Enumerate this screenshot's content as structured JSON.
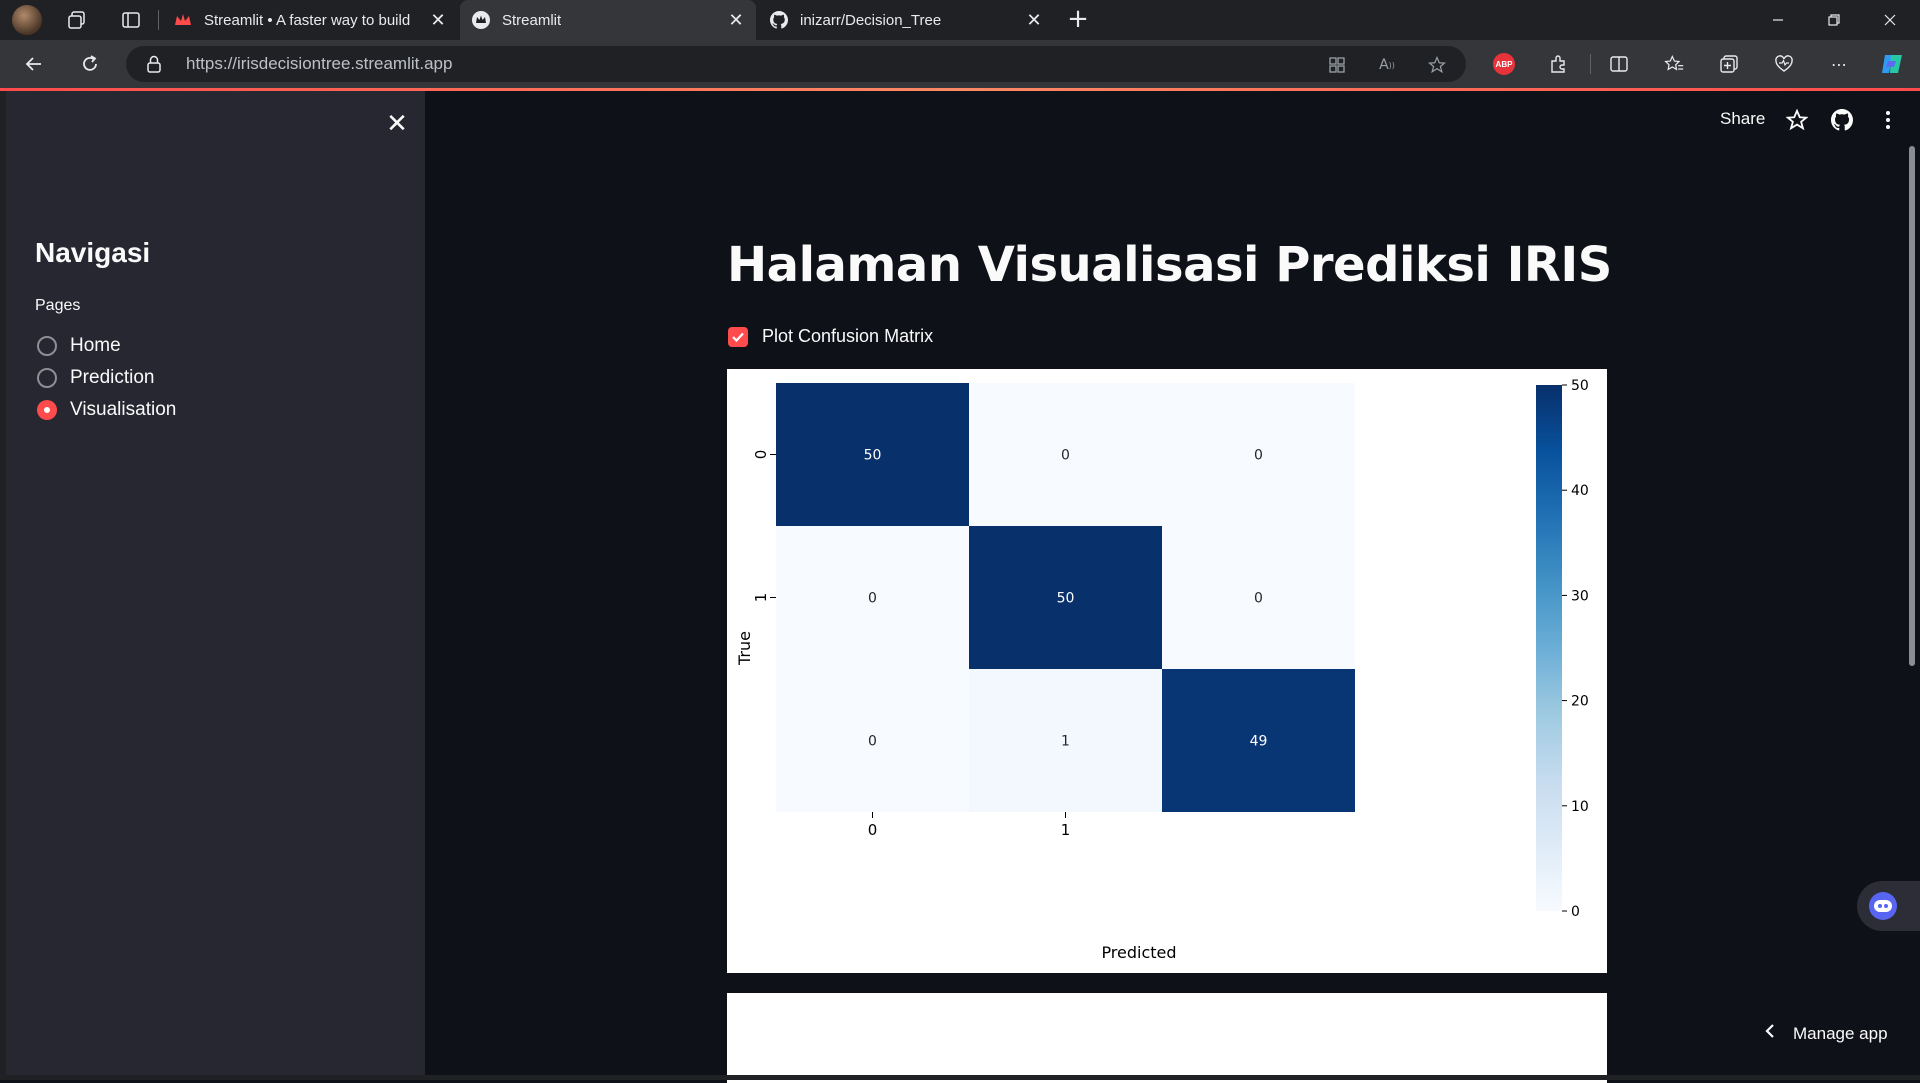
{
  "browser": {
    "tabs": [
      {
        "title": "Streamlit • A faster way to build a"
      },
      {
        "title": "Streamlit"
      },
      {
        "title": "inizarr/Decision_Tree"
      }
    ],
    "url": "https://irisdecisiontree.streamlit.app",
    "abp_label": "ABP"
  },
  "app": {
    "header": {
      "share_label": "Share"
    },
    "sidebar": {
      "title": "Navigasi",
      "pages_label": "Pages",
      "options": [
        {
          "label": "Home",
          "selected": false
        },
        {
          "label": "Prediction",
          "selected": false
        },
        {
          "label": "Visualisation",
          "selected": true
        }
      ]
    },
    "main": {
      "title": "Halaman Visualisasi Prediksi IRIS",
      "checkbox_label": "Plot Confusion Matrix",
      "checkbox_checked": true
    },
    "manage_app_label": "Manage app"
  },
  "colors": {
    "accent": "#ff4b4b",
    "sidebar_bg": "#262730",
    "main_bg": "#0e1117",
    "cmap_high": "#08306b",
    "cmap_low": "#f7fbff"
  },
  "chart_data": {
    "type": "heatmap",
    "matrix": [
      [
        50,
        0,
        0
      ],
      [
        0,
        50,
        0
      ],
      [
        0,
        1,
        49
      ]
    ],
    "x_tick_labels": [
      "0",
      "1"
    ],
    "y_tick_labels": [
      "0",
      "1"
    ],
    "xlabel": "Predicted",
    "ylabel": "True",
    "colorbar_ticks": [
      0,
      10,
      20,
      30,
      40,
      50
    ],
    "vmin": 0,
    "vmax": 50,
    "colormap": "Blues"
  }
}
